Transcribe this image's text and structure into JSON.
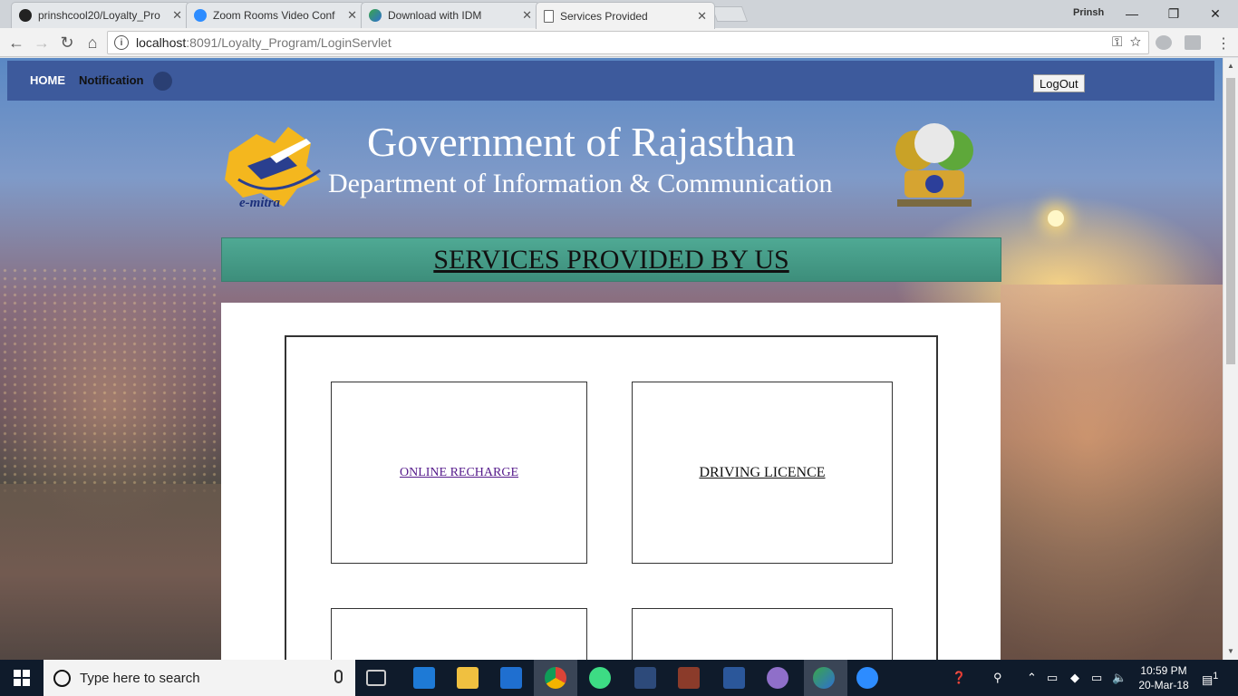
{
  "browser": {
    "tabs": [
      {
        "title": "prinshcool20/Loyalty_Pro",
        "icon": "github-icon"
      },
      {
        "title": "Zoom Rooms Video Conf",
        "icon": "zoom-icon"
      },
      {
        "title": "Download with IDM",
        "icon": "idm-icon"
      },
      {
        "title": "Services Provided",
        "icon": "document-icon",
        "active": true
      }
    ],
    "profile_name": "Prinsh",
    "address": {
      "host": "localhost",
      "path": ":8091/Loyalty_Program/LoginServlet"
    }
  },
  "page": {
    "nav": {
      "home": "HOME",
      "notification": "Notification",
      "logout": "LogOut"
    },
    "header": {
      "logo_text": "e-mitra",
      "title": "Government of Rajasthan",
      "subtitle": "Department of Information & Communication"
    },
    "banner": "SERVICES PROVIDED BY US",
    "services": [
      {
        "label": "ONLINE RECHARGE",
        "visited": true
      },
      {
        "label": "DRIVING LICENCE",
        "visited": false
      }
    ]
  },
  "taskbar": {
    "search_placeholder": "Type here to search",
    "time": "10:59 PM",
    "date": "20-Mar-18",
    "notification_count": "1"
  },
  "colors": {
    "nav_bar": "#3d5a9c",
    "banner": "#4fa994",
    "visited_link": "#551a8b"
  }
}
